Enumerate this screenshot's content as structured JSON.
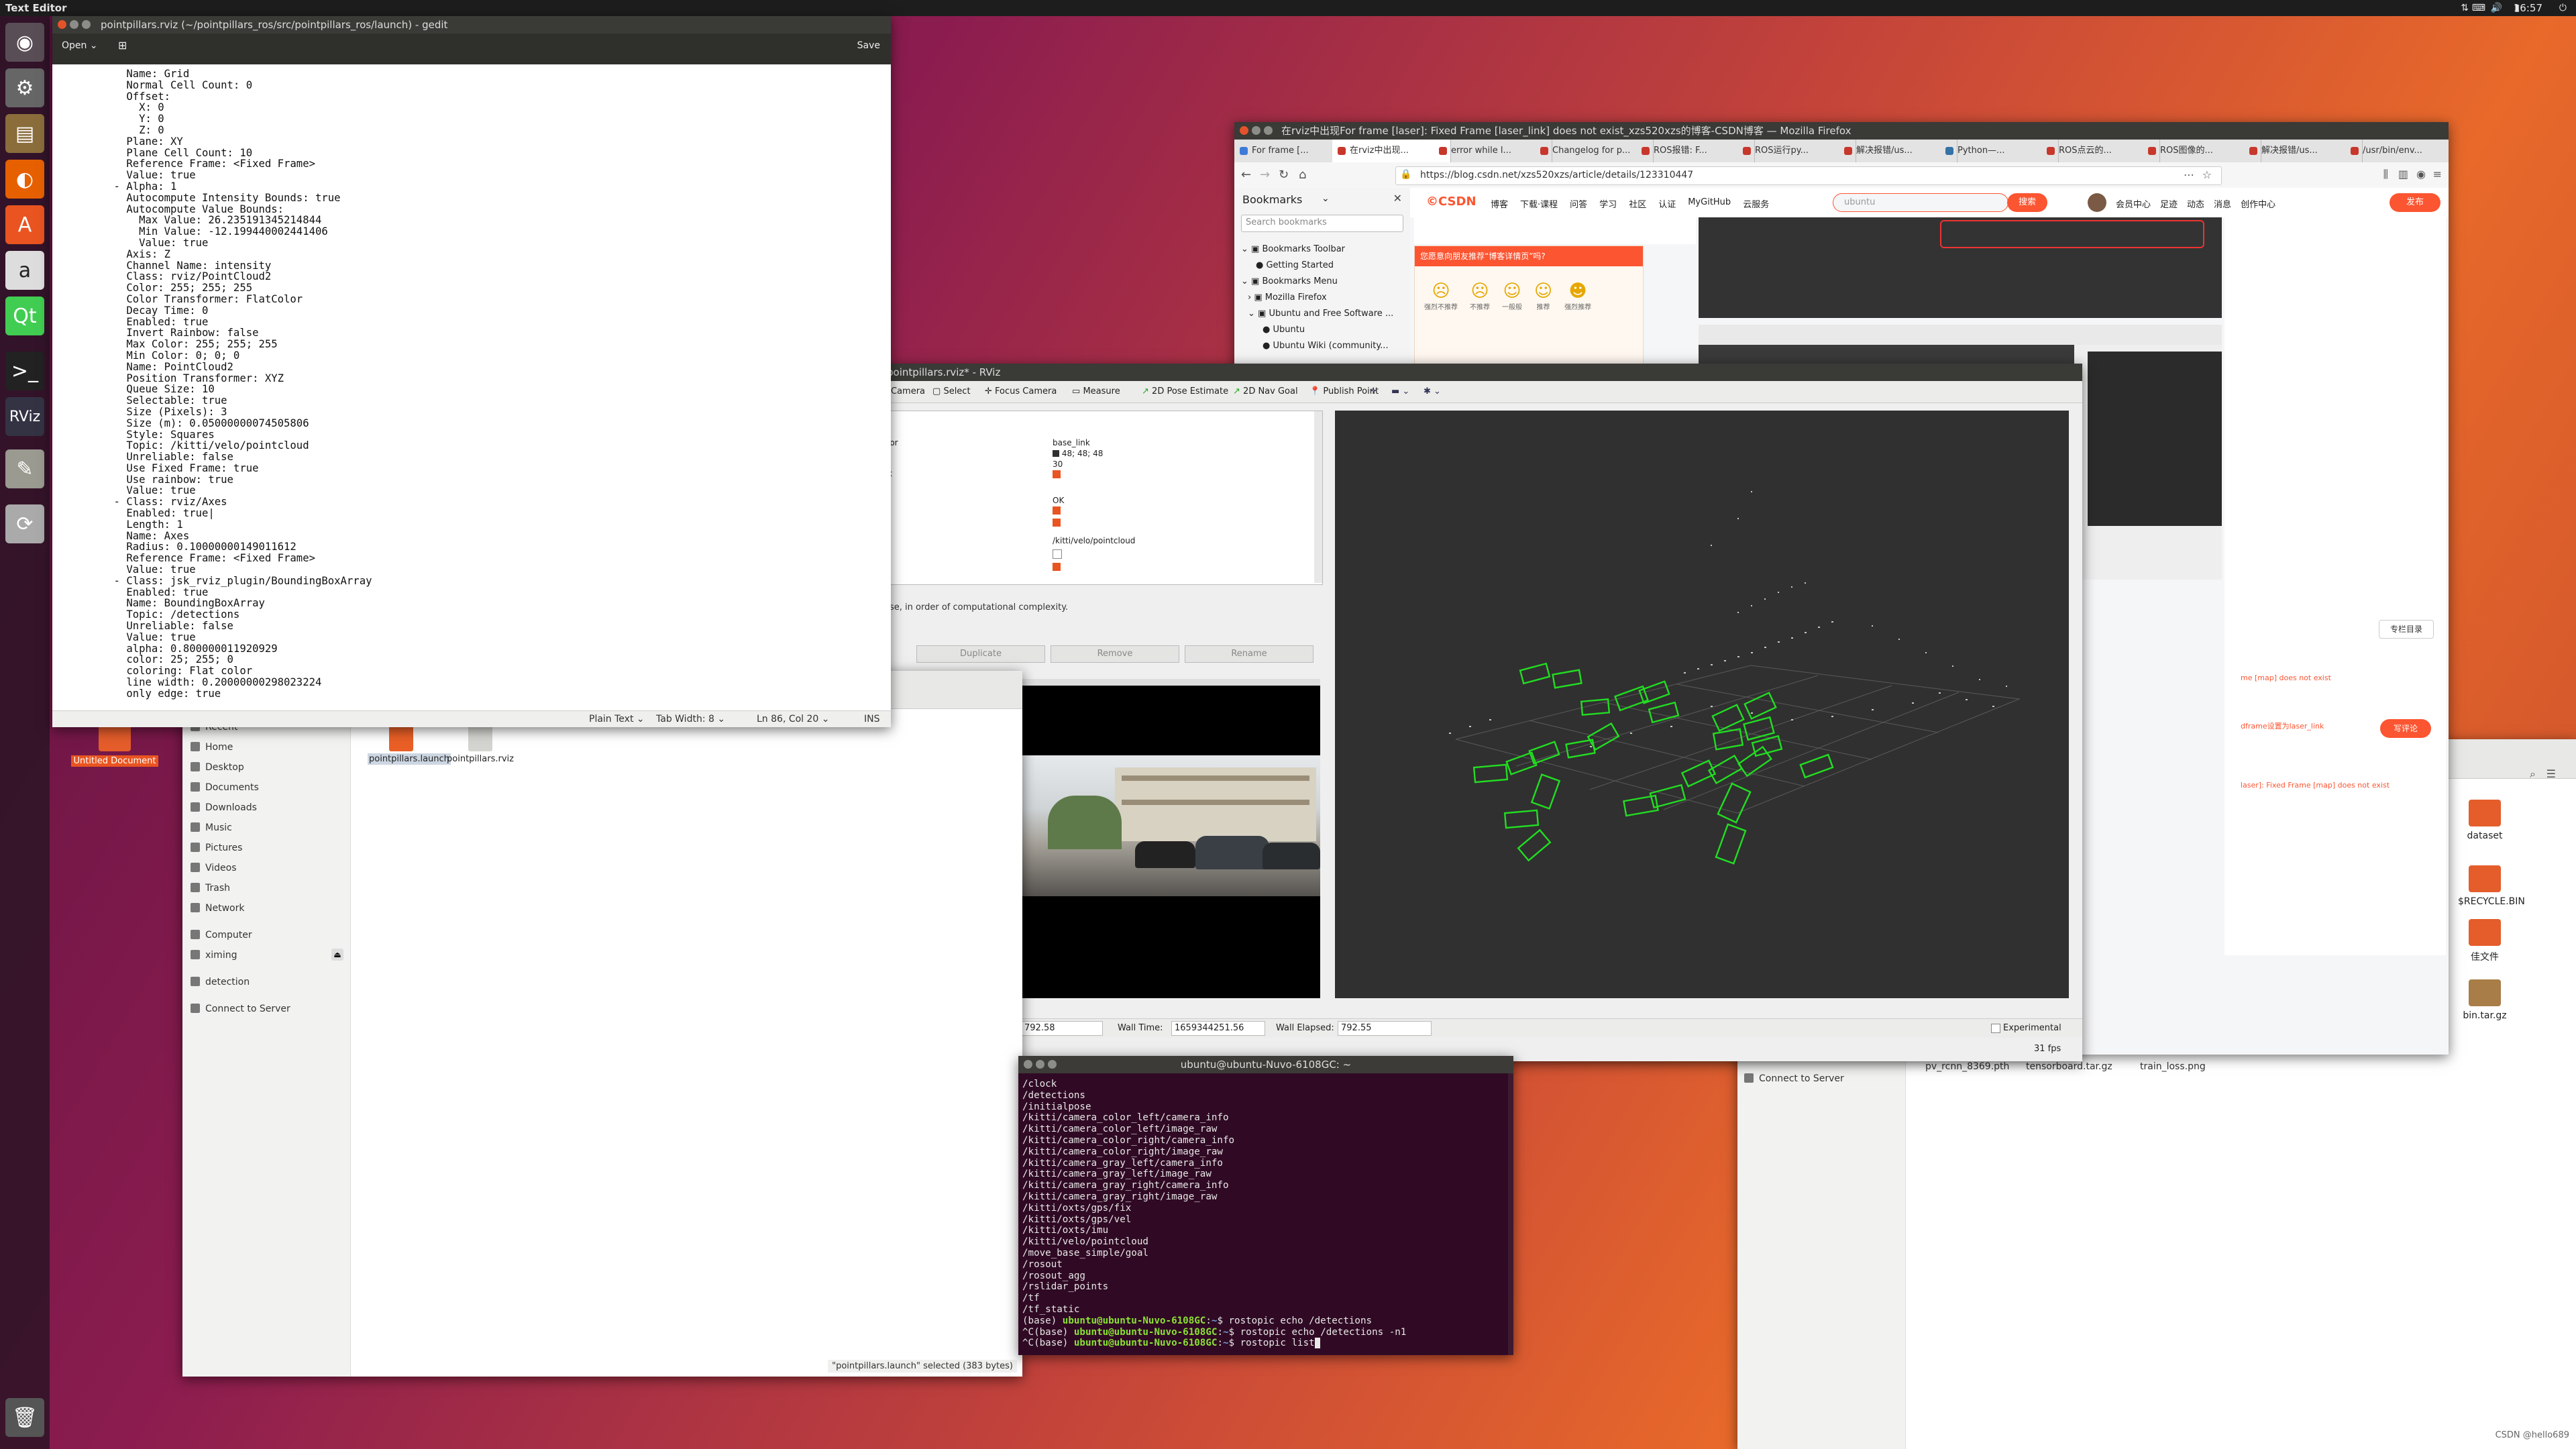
{
  "topbar": {
    "app_name": "Text Editor",
    "clock": "16:57"
  },
  "gedit": {
    "title": "pointpillars.rviz (~/pointpillars_ros/src/pointpillars_ros/launch) - gedit",
    "open_label": "Open",
    "save_label": "Save",
    "content": "      Name: Grid\n      Normal Cell Count: 0\n      Offset:\n        X: 0\n        Y: 0\n        Z: 0\n      Plane: XY\n      Plane Cell Count: 10\n      Reference Frame: <Fixed Frame>\n      Value: true\n    - Alpha: 1\n      Autocompute Intensity Bounds: true\n      Autocompute Value Bounds:\n        Max Value: 26.235191345214844\n        Min Value: -12.199440002441406\n        Value: true\n      Axis: Z\n      Channel Name: intensity\n      Class: rviz/PointCloud2\n      Color: 255; 255; 255\n      Color Transformer: FlatColor\n      Decay Time: 0\n      Enabled: true\n      Invert Rainbow: false\n      Max Color: 255; 255; 255\n      Min Color: 0; 0; 0\n      Name: PointCloud2\n      Position Transformer: XYZ\n      Queue Size: 10\n      Selectable: true\n      Size (Pixels): 3\n      Size (m): 0.05000000074505806\n      Style: Squares\n      Topic: /kitti/velo/pointcloud\n      Unreliable: false\n      Use Fixed Frame: true\n      Use rainbow: true\n      Value: true\n    - Class: rviz/Axes\n      Enabled: true|\n      Length: 1\n      Name: Axes\n      Radius: 0.10000000149011612\n      Reference Frame: <Fixed Frame>\n      Value: true\n    - Class: jsk_rviz_plugin/BoundingBoxArray\n      Enabled: true\n      Name: BoundingBoxArray\n      Topic: /detections\n      Unreliable: false\n      Value: true\n      alpha: 0.800000011920929\n      color: 25; 255; 0\n      coloring: Flat color\n      line width: 0.20000000298023224\n      only edge: true",
    "status": {
      "syntax": "Plain Text",
      "tab_width": "Tab Width: 8",
      "position": "Ln 86, Col 20",
      "mode": "INS"
    }
  },
  "firefox": {
    "title": "在rviz中出现For frame [laser]: Fixed Frame [laser_link] does not exist_xzs520xzs的博客-CSDN博客 — Mozilla Firefox",
    "tabs": [
      "For frame [...",
      "在rviz中出现...",
      "error while l...",
      "Changelog for p...",
      "ROS报错: F...",
      "ROS运行py...",
      "解决报错/us...",
      "Python—...",
      "ROS点云的...",
      "ROS图像的...",
      "解决报错/us...",
      "/usr/bin/env..."
    ],
    "url": "https://blog.csdn.net/xzs520xzs/article/details/123310447",
    "bookmarks_title": "Bookmarks",
    "search_bookmarks": "Search bookmarks",
    "bookmark_items": [
      "Bookmarks Toolbar",
      "Getting Started",
      "Bookmarks Menu",
      "Mozilla Firefox",
      "Ubuntu and Free Software ...",
      "Ubuntu",
      "Ubuntu Wiki (community..."
    ],
    "csdn_nav": [
      "博客",
      "下载·课程",
      "问答",
      "学习",
      "社区",
      "认证",
      "MyGitHub",
      "云服务"
    ],
    "csdn_search": "ubuntu",
    "csdn_search_btn": "搜索",
    "csdn_user": [
      "会员中心",
      "足迹",
      "动态",
      "消息",
      "创作中心"
    ],
    "csdn_publish": "发布",
    "feedback_prompt": "您愿意向朋友推荐“博客详情页”吗?",
    "feedback_options": [
      "强烈不推荐",
      "不推荐",
      "一般般",
      "推荐",
      "强烈推荐"
    ],
    "comment_btn": "写评论",
    "collapse_btn": "专栏目录"
  },
  "rviz": {
    "title": "pointpillars.rviz* - RViz",
    "tools": [
      "Camera",
      "Select",
      "Focus Camera",
      "Measure",
      "2D Pose Estimate",
      "2D Nav Goal",
      "Publish Point"
    ],
    "props_left": [
      "lor",
      "k"
    ],
    "props_right": [
      "base_link",
      "48; 48; 48",
      "30",
      "OK",
      "/kitti/velo/pointcloud"
    ],
    "desc": "se, in order of computational complexity.",
    "buttons": [
      "Duplicate",
      "Remove",
      "Rename"
    ],
    "ros_time": "792.58",
    "wall_time_label": "Wall Time:",
    "wall_time": "1659344251.56",
    "wall_elapsed_label": "Wall Elapsed:",
    "wall_elapsed": "792.55",
    "experimental": "Experimental",
    "fps": "31 fps"
  },
  "files": {
    "sidebar": [
      "Recent",
      "Home",
      "Desktop",
      "Documents",
      "Downloads",
      "Music",
      "Pictures",
      "Videos",
      "Trash",
      "Network",
      "Computer",
      "ximing",
      "detection",
      "Connect to Server"
    ],
    "items": [
      "pointpillars.launch",
      "pointpillars.rviz"
    ],
    "status": "\"pointpillars.launch\" selected (383 bytes)"
  },
  "terminal": {
    "title": "ubuntu@ubuntu-Nuvo-6108GC: ~",
    "topics": [
      "/clock",
      "/detections",
      "/initialpose",
      "/kitti/camera_color_left/camera_info",
      "/kitti/camera_color_left/image_raw",
      "/kitti/camera_color_right/camera_info",
      "/kitti/camera_color_right/image_raw",
      "/kitti/camera_gray_left/camera_info",
      "/kitti/camera_gray_left/image_raw",
      "/kitti/camera_gray_right/camera_info",
      "/kitti/camera_gray_right/image_raw",
      "/kitti/oxts/gps/fix",
      "/kitti/oxts/gps/vel",
      "/kitti/oxts/imu",
      "/kitti/velo/pointcloud",
      "/move_base_simple/goal",
      "/rosout",
      "/rosout_agg",
      "/rslidar_points",
      "/tf",
      "/tf_static"
    ],
    "prompt": "(base) ",
    "user": "ubuntu@ubuntu-Nuvo-6108GC",
    "cmds": [
      "$ rostopic echo /detections",
      "$ rostopic echo /detections -n1",
      "$ rostopic list"
    ],
    "ctrl_c": "^C"
  },
  "files2": {
    "connect": "Connect to Server",
    "items": [
      "pv_rcnn_8369.pth",
      "tensorboard.tar.gz",
      "train_loss.png"
    ],
    "desktop_icons": [
      "dataset",
      "$RECYCLE.BIN",
      "佳文件",
      "bin.tar.gz"
    ],
    "watermark": "CSDN @hello689"
  },
  "desktop": {
    "untitled": "Untitled Document"
  },
  "colors": {
    "accent": "#e95420",
    "csdn_red": "#fc5531",
    "bbox_green": "#22dd22",
    "terminal_bg": "#300a24"
  }
}
